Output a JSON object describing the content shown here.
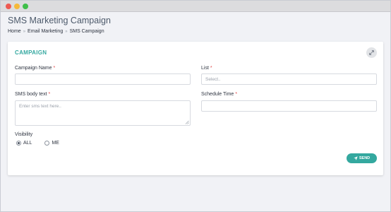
{
  "page": {
    "title": "SMS Marketing Campaign"
  },
  "breadcrumb": [
    "Home",
    "Email Marketing",
    "SMS Campaign"
  ],
  "card": {
    "title": "CAMPAIGN"
  },
  "form": {
    "campaign_name": {
      "label": "Campaign Name",
      "required": "*",
      "value": ""
    },
    "list": {
      "label": "List",
      "required": "*",
      "placeholder": "Select.."
    },
    "sms_body": {
      "label": "SMS body text",
      "required": "*",
      "placeholder": "Enter sms text here.."
    },
    "schedule_time": {
      "label": "Schedule Time",
      "required": "*",
      "value": ""
    },
    "visibility": {
      "label": "Visibility",
      "options": [
        {
          "label": "ALL",
          "checked": true
        },
        {
          "label": "ME",
          "checked": false
        }
      ]
    },
    "send_label": "SEND"
  },
  "colors": {
    "accent": "#36a9a1",
    "required": "#e24a4a",
    "button": "#34a89f"
  }
}
